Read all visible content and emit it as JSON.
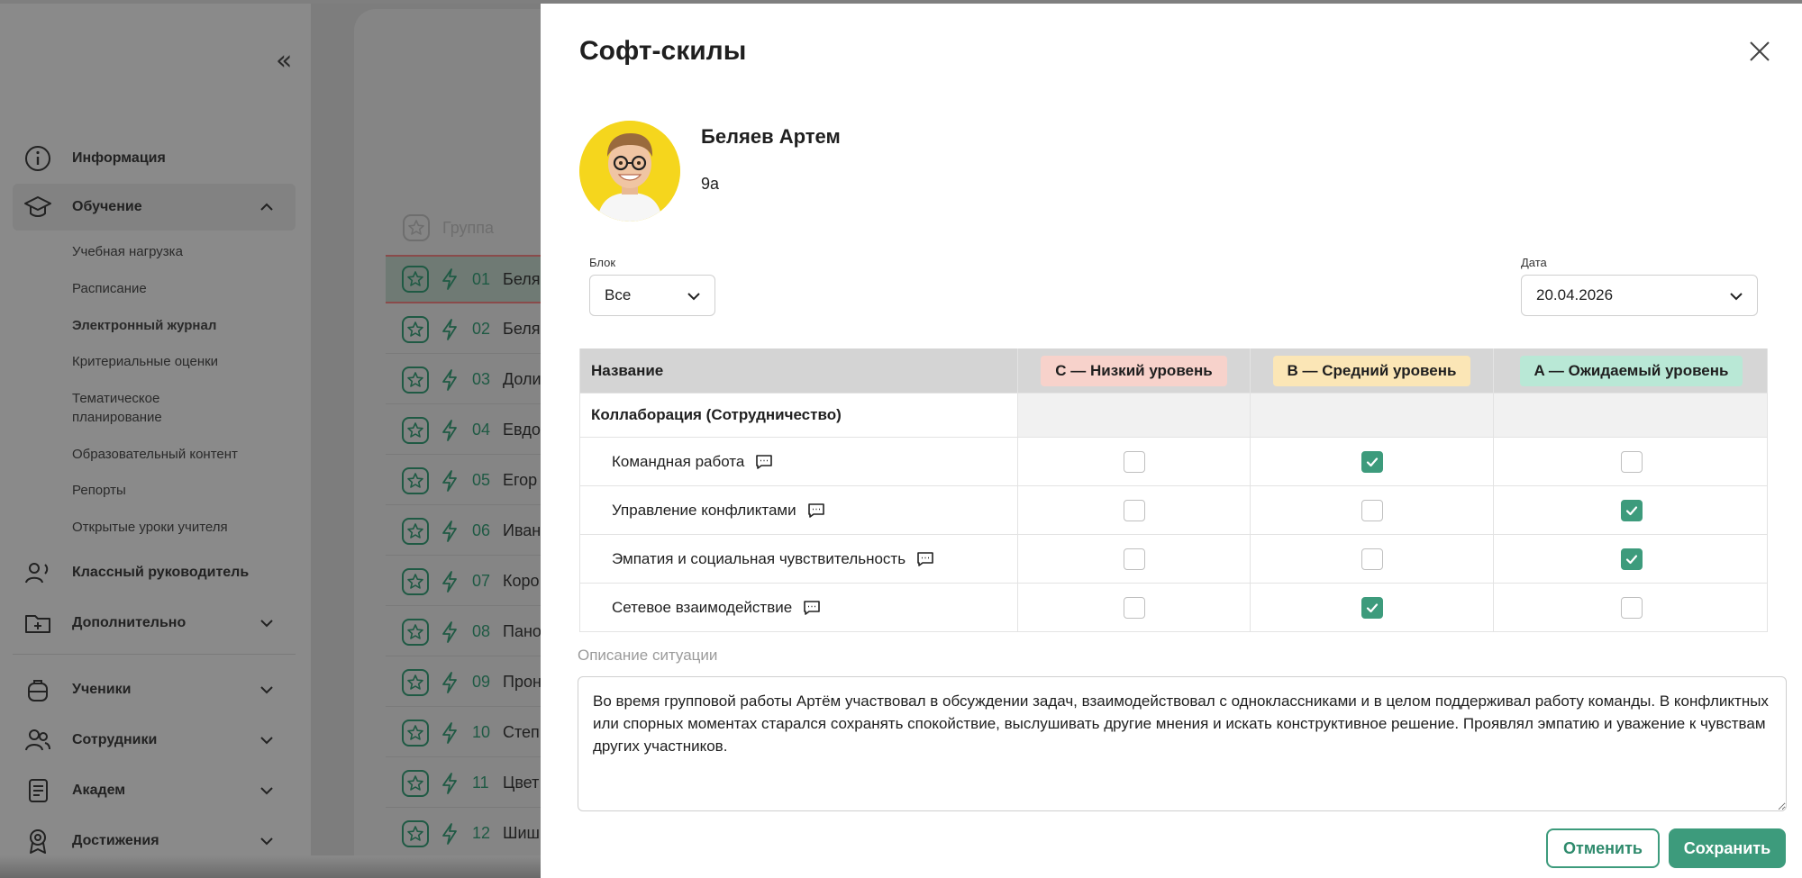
{
  "sidebar": {
    "items": [
      {
        "label": "Информация",
        "icon": "info-icon"
      },
      {
        "label": "Обучение",
        "icon": "graduation-cap-icon"
      },
      {
        "label": "Классный руководитель",
        "icon": "teacher-icon"
      },
      {
        "label": "Дополнительно",
        "icon": "folder-plus-icon"
      },
      {
        "label": "Ученики",
        "icon": "backpack-icon"
      },
      {
        "label": "Сотрудники",
        "icon": "users-icon"
      },
      {
        "label": "Академ",
        "icon": "document-icon"
      },
      {
        "label": "Достижения",
        "icon": "award-icon"
      }
    ],
    "sub_items": [
      "Учебная нагрузка",
      "Расписание",
      "Электронный журнал",
      "Критериальные оценки",
      "Тематическое планирование",
      "Образовательный контент",
      "Репорты",
      "Открытые уроки учителя"
    ]
  },
  "list": {
    "header": "Группа",
    "rows": [
      {
        "num": "01",
        "name": "Беля"
      },
      {
        "num": "02",
        "name": "Беля"
      },
      {
        "num": "03",
        "name": "Доли"
      },
      {
        "num": "04",
        "name": "Евдо"
      },
      {
        "num": "05",
        "name": "Егор"
      },
      {
        "num": "06",
        "name": "Иван"
      },
      {
        "num": "07",
        "name": "Коро"
      },
      {
        "num": "08",
        "name": "Пано"
      },
      {
        "num": "09",
        "name": "Прон"
      },
      {
        "num": "10",
        "name": "Степ"
      },
      {
        "num": "11",
        "name": "Цвет"
      },
      {
        "num": "12",
        "name": "Шиш"
      }
    ]
  },
  "modal": {
    "title": "Софт-скилы",
    "student": {
      "name": "Беляев Артем",
      "class": "9а"
    },
    "block": {
      "label": "Блок",
      "value": "Все"
    },
    "date": {
      "label": "Дата",
      "value": "20.04.2026"
    },
    "table": {
      "headers": [
        "Название",
        "C — Низкий уровень",
        "B — Средний уровень",
        "A — Ожидаемый уровень"
      ],
      "group": "Коллаборация (Сотрудничество)",
      "rows": [
        {
          "name": "Командная работа",
          "checked": [
            false,
            true,
            false
          ]
        },
        {
          "name": "Управление конфликтами",
          "checked": [
            false,
            false,
            true
          ]
        },
        {
          "name": "Эмпатия и социальная чувствительность",
          "checked": [
            false,
            false,
            true
          ]
        },
        {
          "name": "Сетевое взаимодействие",
          "checked": [
            false,
            true,
            false
          ]
        }
      ]
    },
    "description": {
      "label": "Описание ситуации",
      "text": "Во время групповой работы Артём участвовал в обсуждении задач, взаимодействовал с одноклассниками и в целом поддерживал работу команды. В конфликтных или спорных моментах старался сохранять спокойствие, выслушивать другие мнения и искать конструктивное решение. Проявлял эмпатию и уважение к чувствам других участников."
    },
    "buttons": {
      "cancel": "Отменить",
      "save": "Сохранить"
    }
  },
  "colors": {
    "accent": "#3d9b7c",
    "level_c": "#f7d2cb",
    "level_b": "#fbe6b6",
    "level_a": "#b9e8d6"
  }
}
